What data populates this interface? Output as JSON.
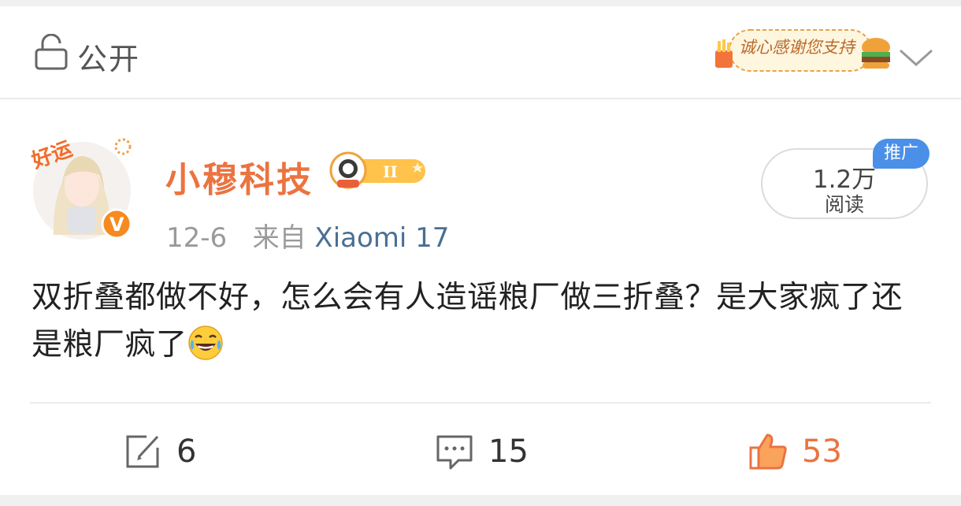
{
  "header": {
    "visibility_label": "公开",
    "sticker_text": "诚心感谢您支持"
  },
  "author": {
    "avatar_badge_text": "好运",
    "name": "小穆科技",
    "level_badge": "II",
    "verified_mark": "V"
  },
  "meta": {
    "date": "12-6",
    "from_label": "来自",
    "source": "Xiaomi 17"
  },
  "stats": {
    "reads_count": "1.2万",
    "reads_label": "阅读",
    "promo_tag": "推广"
  },
  "post": {
    "text": "双折叠都做不好，怎么会有人造谣粮厂做三折叠？是大家疯了还是粮厂疯了"
  },
  "actions": {
    "repost_count": "6",
    "comment_count": "15",
    "like_count": "53"
  },
  "colors": {
    "accent": "#eb7340",
    "link": "#4a6f94",
    "promo": "#4a8fe8"
  }
}
